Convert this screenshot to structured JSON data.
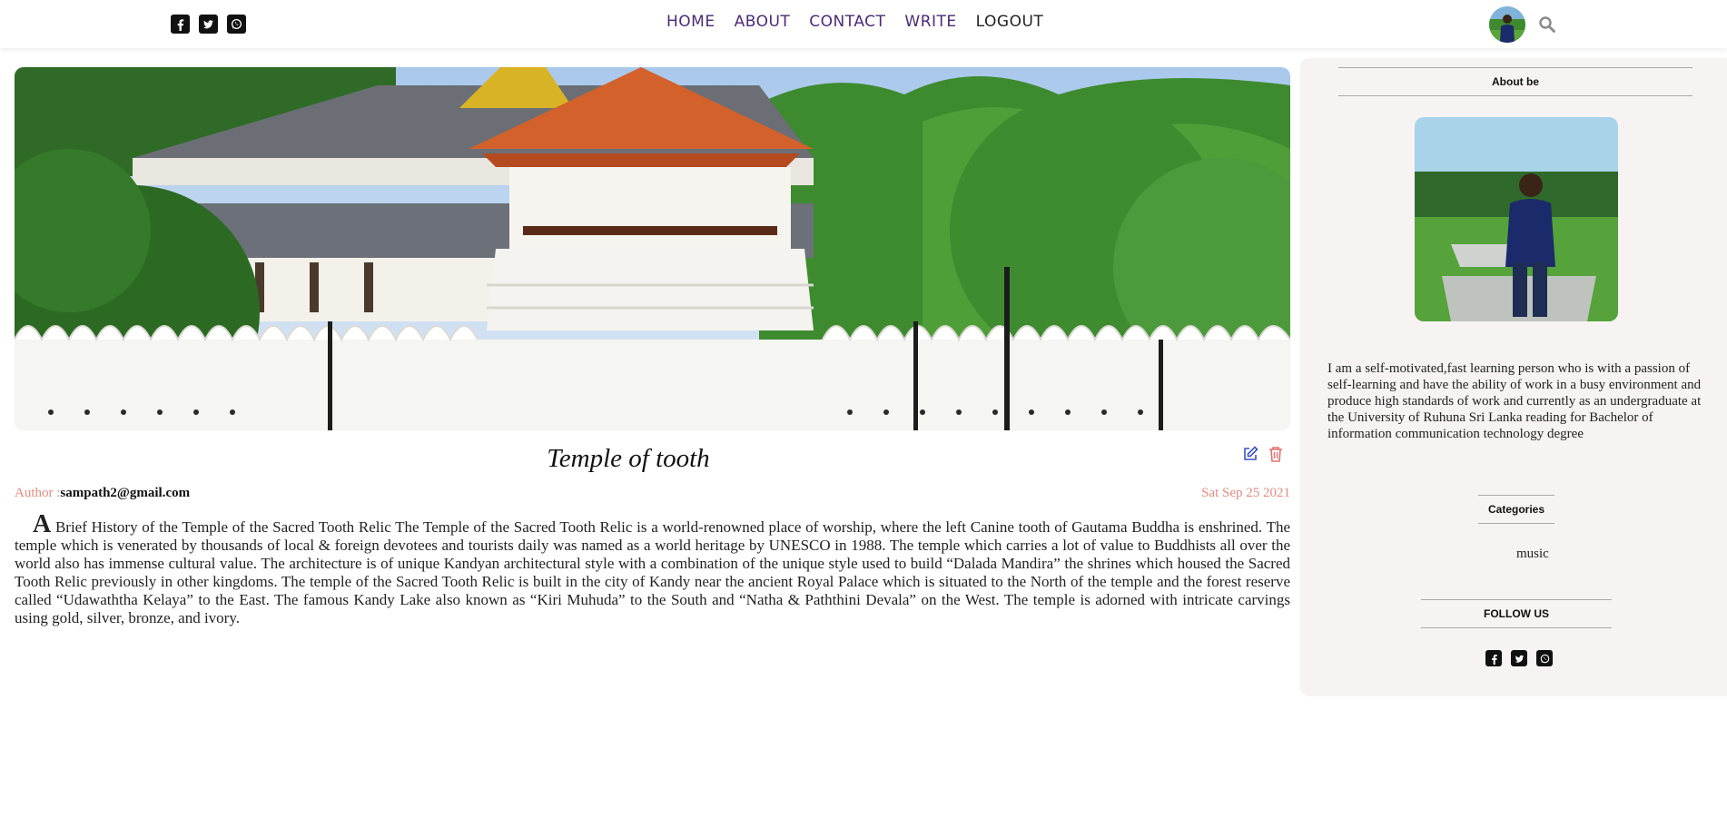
{
  "nav": {
    "home": "HOME",
    "about": "ABOUT",
    "contact": "CONTACT",
    "write": "WRITE",
    "logout": "LOGOUT"
  },
  "social_icons": [
    "facebook-icon",
    "twitter-icon",
    "whatsapp-icon"
  ],
  "post": {
    "title": "Temple of tooth",
    "author_label": "Author :",
    "author": "sampath2@gmail.com",
    "date": "Sat Sep 25 2021",
    "dropcap": "A",
    "body": " Brief History of the Temple of the Sacred Tooth Relic The Temple of the Sacred Tooth Relic is a world-renowned place of worship, where the left Canine tooth of Gautama Buddha is enshrined. The temple which is venerated by thousands of local & foreign devotees and tourists daily was named as a world heritage by UNESCO in 1988. The temple which carries a lot of value to Buddhists all over the world also has immense cultural value. The architecture is of unique Kandyan architectural style with a combination of the unique style used to build “Dalada Mandira” the shrines which housed the Sacred Tooth Relic previously in other kingdoms. The temple of the Sacred Tooth Relic is built in the city of Kandy near the ancient Royal Palace which is situated to the North of the temple and the forest reserve called “Udawaththa Kelaya” to the East. The famous Kandy Lake also known as “Kiri Muhuda” to the South and “Natha & Paththini Devala” on the West. The temple is adorned with intricate carvings using gold, silver, bronze, and ivory."
  },
  "sidebar": {
    "about_heading": "About be",
    "about_text": "I am a self-motivated,fast learning person who is with a passion of self-learning and have the ability of work in a busy environment and produce high standards of work and currently as an undergraduate at the University of Ruhuna Sri Lanka reading for Bachelor of information communication technology degree",
    "categories_heading": "Categories",
    "categories": [
      "music"
    ],
    "follow_heading": "FOLLOW US"
  },
  "colors": {
    "nav_link": "#4b2a78",
    "meta_accent": "#e58a7f",
    "edit_icon": "#3b52c4",
    "delete_icon": "#e07070",
    "sidebar_bg": "#f6f3f2"
  }
}
